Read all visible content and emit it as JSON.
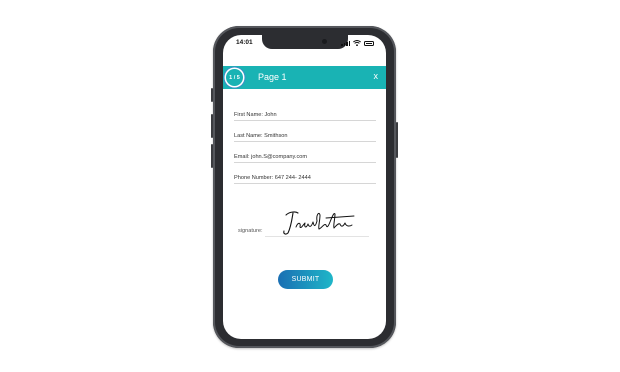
{
  "status_bar": {
    "time": "14:01"
  },
  "header": {
    "page_badge": "1 / 5",
    "title": "Page 1",
    "close_label": "x"
  },
  "form": {
    "first_name": "First Name: John",
    "last_name": "Last Name: Smithson",
    "email": "Email: john.S@company.com",
    "phone": "Phone Number: 647 244- 2444",
    "signature_label": "signature:",
    "signature_text": "John Smithson"
  },
  "submit": {
    "label": "SUBMIT"
  },
  "colors": {
    "header": "#19b3b4",
    "badge_ring": "#3d8fc7",
    "button_start": "#1a6fb3",
    "button_end": "#1fb6c8",
    "phone_frame": "#2c2d31"
  },
  "icons": [
    "signal-bars-icon",
    "wifi-icon",
    "battery-icon",
    "close-icon"
  ]
}
